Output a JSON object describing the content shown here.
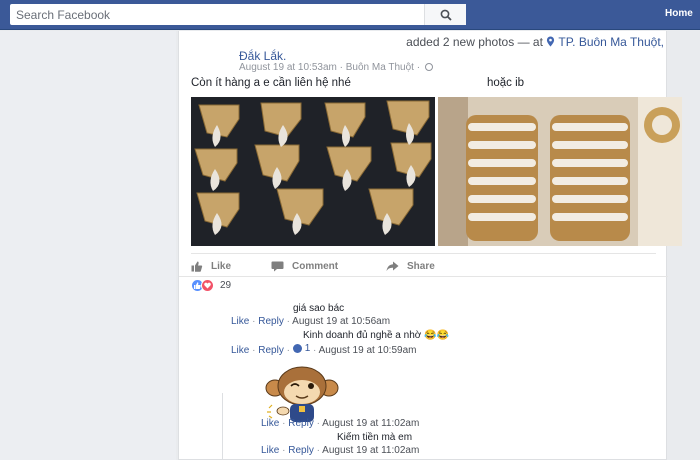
{
  "topbar": {
    "search_placeholder": "Search Facebook",
    "home_label": "Home"
  },
  "post": {
    "header_action": "added 2 new photos",
    "header_sep": " — at ",
    "location": "TP. Buôn Ma Thuột,",
    "location_cont": "Đắk Lắk.",
    "timestamp": "August 19 at 10:53am",
    "meta_sep": " · ",
    "meta_location": "Buôn Ma Thuột",
    "text": "Còn ít hàng a e cần liên hệ nhé",
    "text_extra": "hoặc ib",
    "photos": [
      "gold-claw-pendants-photo",
      "gold-bangles-photo"
    ]
  },
  "actions": {
    "like": "Like",
    "comment": "Comment",
    "share": "Share"
  },
  "reactions": {
    "count": "29"
  },
  "comments": [
    {
      "text": "giá sao bác",
      "like": "Like",
      "reply": "Reply",
      "time": "August 19 at 10:56am"
    },
    {
      "text": "Kinh doanh đủ nghề a nhờ 😂😂",
      "like": "Like",
      "reply": "Reply",
      "reply_count": "1",
      "time": "August 19 at 10:59am"
    },
    {
      "sticker": "monkey-sticker",
      "like": "Like",
      "reply": "Reply",
      "time": "August 19 at 11:02am"
    },
    {
      "text": "Kiếm tiền mà em",
      "like": "Like",
      "reply": "Reply",
      "time": "August 19 at 11:02am"
    }
  ],
  "separators": {
    "dot": " · "
  }
}
